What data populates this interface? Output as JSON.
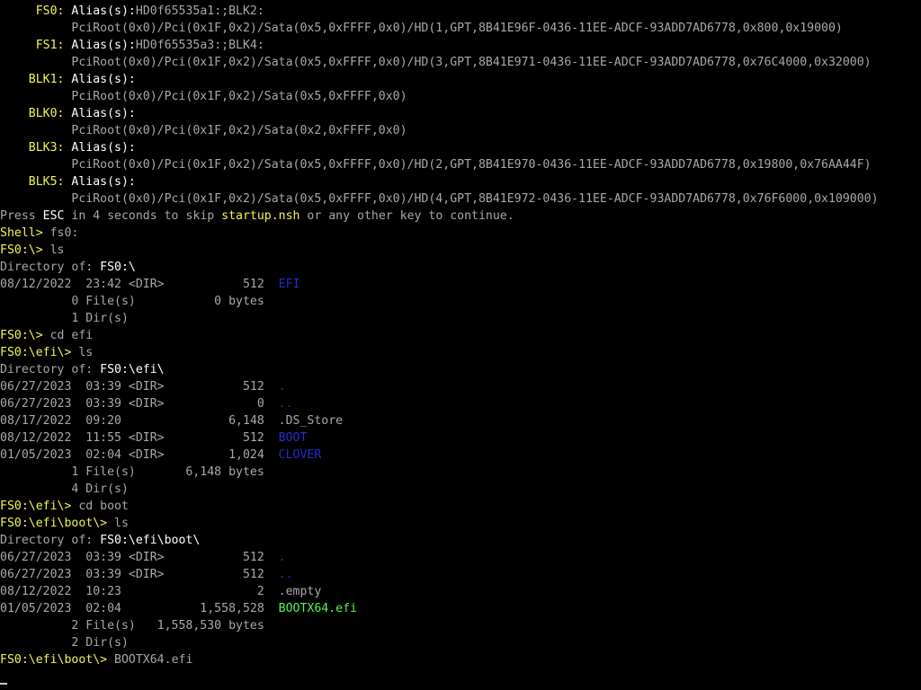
{
  "colors": {
    "background": "#000000",
    "text": "#a8a8a8",
    "highlight": "#f4f454",
    "directory": "#2a2acf",
    "executable": "#54f454",
    "bright": "#ffffff"
  },
  "lines": [
    [
      {
        "t": "     FS0: ",
        "c": "yellow"
      },
      {
        "t": "Alias(s):",
        "c": "brightwhite"
      },
      {
        "t": "HD0f65535a1:;BLK2:",
        "c": "gray"
      }
    ],
    [
      {
        "t": "          PciRoot(0x0)/Pci(0x1F,0x2)/Sata(0x5,0xFFFF,0x0)/HD(1,GPT,8B41E96F-0436-11EE-ADCF-93ADD7AD6778,0x800,0x19000)",
        "c": "gray"
      }
    ],
    [
      {
        "t": "     FS1: ",
        "c": "yellow"
      },
      {
        "t": "Alias(s):",
        "c": "brightwhite"
      },
      {
        "t": "HD0f65535a3:;BLK4:",
        "c": "gray"
      }
    ],
    [
      {
        "t": "          PciRoot(0x0)/Pci(0x1F,0x2)/Sata(0x5,0xFFFF,0x0)/HD(3,GPT,8B41E971-0436-11EE-ADCF-93ADD7AD6778,0x76C4000,0x32000)",
        "c": "gray"
      }
    ],
    [
      {
        "t": "    BLK1: ",
        "c": "yellow"
      },
      {
        "t": "Alias(s):",
        "c": "brightwhite"
      }
    ],
    [
      {
        "t": "          PciRoot(0x0)/Pci(0x1F,0x2)/Sata(0x5,0xFFFF,0x0)",
        "c": "gray"
      }
    ],
    [
      {
        "t": "    BLK0: ",
        "c": "yellow"
      },
      {
        "t": "Alias(s):",
        "c": "brightwhite"
      }
    ],
    [
      {
        "t": "          PciRoot(0x0)/Pci(0x1F,0x2)/Sata(0x2,0xFFFF,0x0)",
        "c": "gray"
      }
    ],
    [
      {
        "t": "    BLK3: ",
        "c": "yellow"
      },
      {
        "t": "Alias(s):",
        "c": "brightwhite"
      }
    ],
    [
      {
        "t": "          PciRoot(0x0)/Pci(0x1F,0x2)/Sata(0x5,0xFFFF,0x0)/HD(2,GPT,8B41E970-0436-11EE-ADCF-93ADD7AD6778,0x19800,0x76AA44F)",
        "c": "gray"
      }
    ],
    [
      {
        "t": "    BLK5: ",
        "c": "yellow"
      },
      {
        "t": "Alias(s):",
        "c": "brightwhite"
      }
    ],
    [
      {
        "t": "          PciRoot(0x0)/Pci(0x1F,0x2)/Sata(0x5,0xFFFF,0x0)/HD(4,GPT,8B41E972-0436-11EE-ADCF-93ADD7AD6778,0x76F6000,0x109000)",
        "c": "gray"
      }
    ],
    [
      {
        "t": "Press ",
        "c": "gray"
      },
      {
        "t": "ESC",
        "c": "brightwhite"
      },
      {
        "t": " in 4 seconds to skip ",
        "c": "gray"
      },
      {
        "t": "startup.nsh",
        "c": "yellow"
      },
      {
        "t": " or any other key to continue.",
        "c": "gray"
      }
    ],
    [
      {
        "t": "Shell> ",
        "c": "yellow"
      },
      {
        "t": "fs0:",
        "c": "gray"
      }
    ],
    [
      {
        "t": "FS0:\\> ",
        "c": "yellow"
      },
      {
        "t": "ls",
        "c": "gray"
      }
    ],
    [
      {
        "t": "Directory of: ",
        "c": "gray"
      },
      {
        "t": "FS0:\\",
        "c": "brightwhite"
      }
    ],
    [
      {
        "t": "08/12/2022  23:42 <DIR>           512  ",
        "c": "gray"
      },
      {
        "t": "EFI",
        "c": "blue"
      }
    ],
    [
      {
        "t": "          0 File(s)           0 bytes",
        "c": "gray"
      }
    ],
    [
      {
        "t": "          1 Dir(s)",
        "c": "gray"
      }
    ],
    [
      {
        "t": "FS0:\\> ",
        "c": "yellow"
      },
      {
        "t": "cd efi",
        "c": "gray"
      }
    ],
    [
      {
        "t": "FS0:\\efi\\> ",
        "c": "yellow"
      },
      {
        "t": "ls",
        "c": "gray"
      }
    ],
    [
      {
        "t": "Directory of: ",
        "c": "gray"
      },
      {
        "t": "FS0:\\efi\\",
        "c": "brightwhite"
      }
    ],
    [
      {
        "t": "06/27/2023  03:39 <DIR>           512  ",
        "c": "gray"
      },
      {
        "t": ".",
        "c": "blue"
      }
    ],
    [
      {
        "t": "06/27/2023  03:39 <DIR>             0  ",
        "c": "gray"
      },
      {
        "t": "..",
        "c": "blue"
      }
    ],
    [
      {
        "t": "08/17/2022  09:20               6,148  .DS_Store",
        "c": "gray"
      }
    ],
    [
      {
        "t": "08/12/2022  11:55 <DIR>           512  ",
        "c": "gray"
      },
      {
        "t": "BOOT",
        "c": "blue"
      }
    ],
    [
      {
        "t": "01/05/2023  02:04 <DIR>         1,024  ",
        "c": "gray"
      },
      {
        "t": "CLOVER",
        "c": "blue"
      }
    ],
    [
      {
        "t": "          1 File(s)       6,148 bytes",
        "c": "gray"
      }
    ],
    [
      {
        "t": "          4 Dir(s)",
        "c": "gray"
      }
    ],
    [
      {
        "t": "FS0:\\efi\\> ",
        "c": "yellow"
      },
      {
        "t": "cd boot",
        "c": "gray"
      }
    ],
    [
      {
        "t": "FS0:\\efi\\boot\\> ",
        "c": "yellow"
      },
      {
        "t": "ls",
        "c": "gray"
      }
    ],
    [
      {
        "t": "Directory of: ",
        "c": "gray"
      },
      {
        "t": "FS0:\\efi\\boot\\",
        "c": "brightwhite"
      }
    ],
    [
      {
        "t": "06/27/2023  03:39 <DIR>           512  ",
        "c": "gray"
      },
      {
        "t": ".",
        "c": "blue"
      }
    ],
    [
      {
        "t": "06/27/2023  03:39 <DIR>           512  ",
        "c": "gray"
      },
      {
        "t": "..",
        "c": "blue"
      }
    ],
    [
      {
        "t": "08/12/2022  10:23                   2  .empty",
        "c": "gray"
      }
    ],
    [
      {
        "t": "01/05/2023  02:04           1,558,528  ",
        "c": "gray"
      },
      {
        "t": "BOOTX64.efi",
        "c": "green"
      }
    ],
    [
      {
        "t": "          2 File(s)   1,558,530 bytes",
        "c": "gray"
      }
    ],
    [
      {
        "t": "          2 Dir(s)",
        "c": "gray"
      }
    ],
    [
      {
        "t": "FS0:\\efi\\boot\\> ",
        "c": "yellow"
      },
      {
        "t": "BOOTX64.efi",
        "c": "gray"
      }
    ]
  ]
}
